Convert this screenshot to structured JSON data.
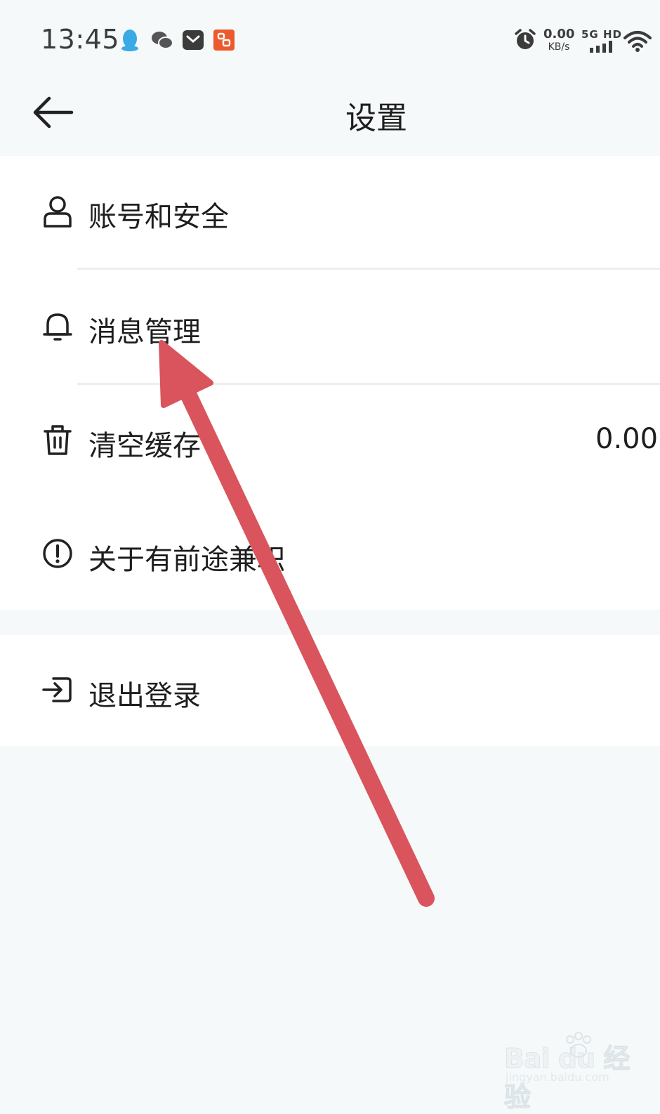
{
  "status_bar": {
    "time": "13:45",
    "apps": [
      "qq-icon",
      "wechat-icon",
      "mail-icon",
      "app-icon"
    ],
    "net_speed_value": "0.00",
    "net_speed_unit": "KB/s",
    "signal_label": "5G HD",
    "icons": [
      "alarm-icon",
      "signal-bars-icon",
      "wifi-icon"
    ]
  },
  "header": {
    "title": "设置",
    "back_icon": "arrow-left-icon"
  },
  "settings": {
    "items": [
      {
        "label": "账号和安全",
        "icon": "user-icon"
      },
      {
        "label": "消息管理",
        "icon": "bell-icon"
      },
      {
        "label": "清空缓存",
        "icon": "trash-icon",
        "value": "0.00"
      },
      {
        "label": "关于有前途兼职",
        "icon": "info-icon"
      }
    ]
  },
  "logout": {
    "label": "退出登录",
    "icon": "logout-icon"
  },
  "annotation": {
    "arrow_color": "#d9545c"
  },
  "watermark": {
    "logo": "Bai du 经验",
    "url": "jingyan.baidu.com"
  }
}
